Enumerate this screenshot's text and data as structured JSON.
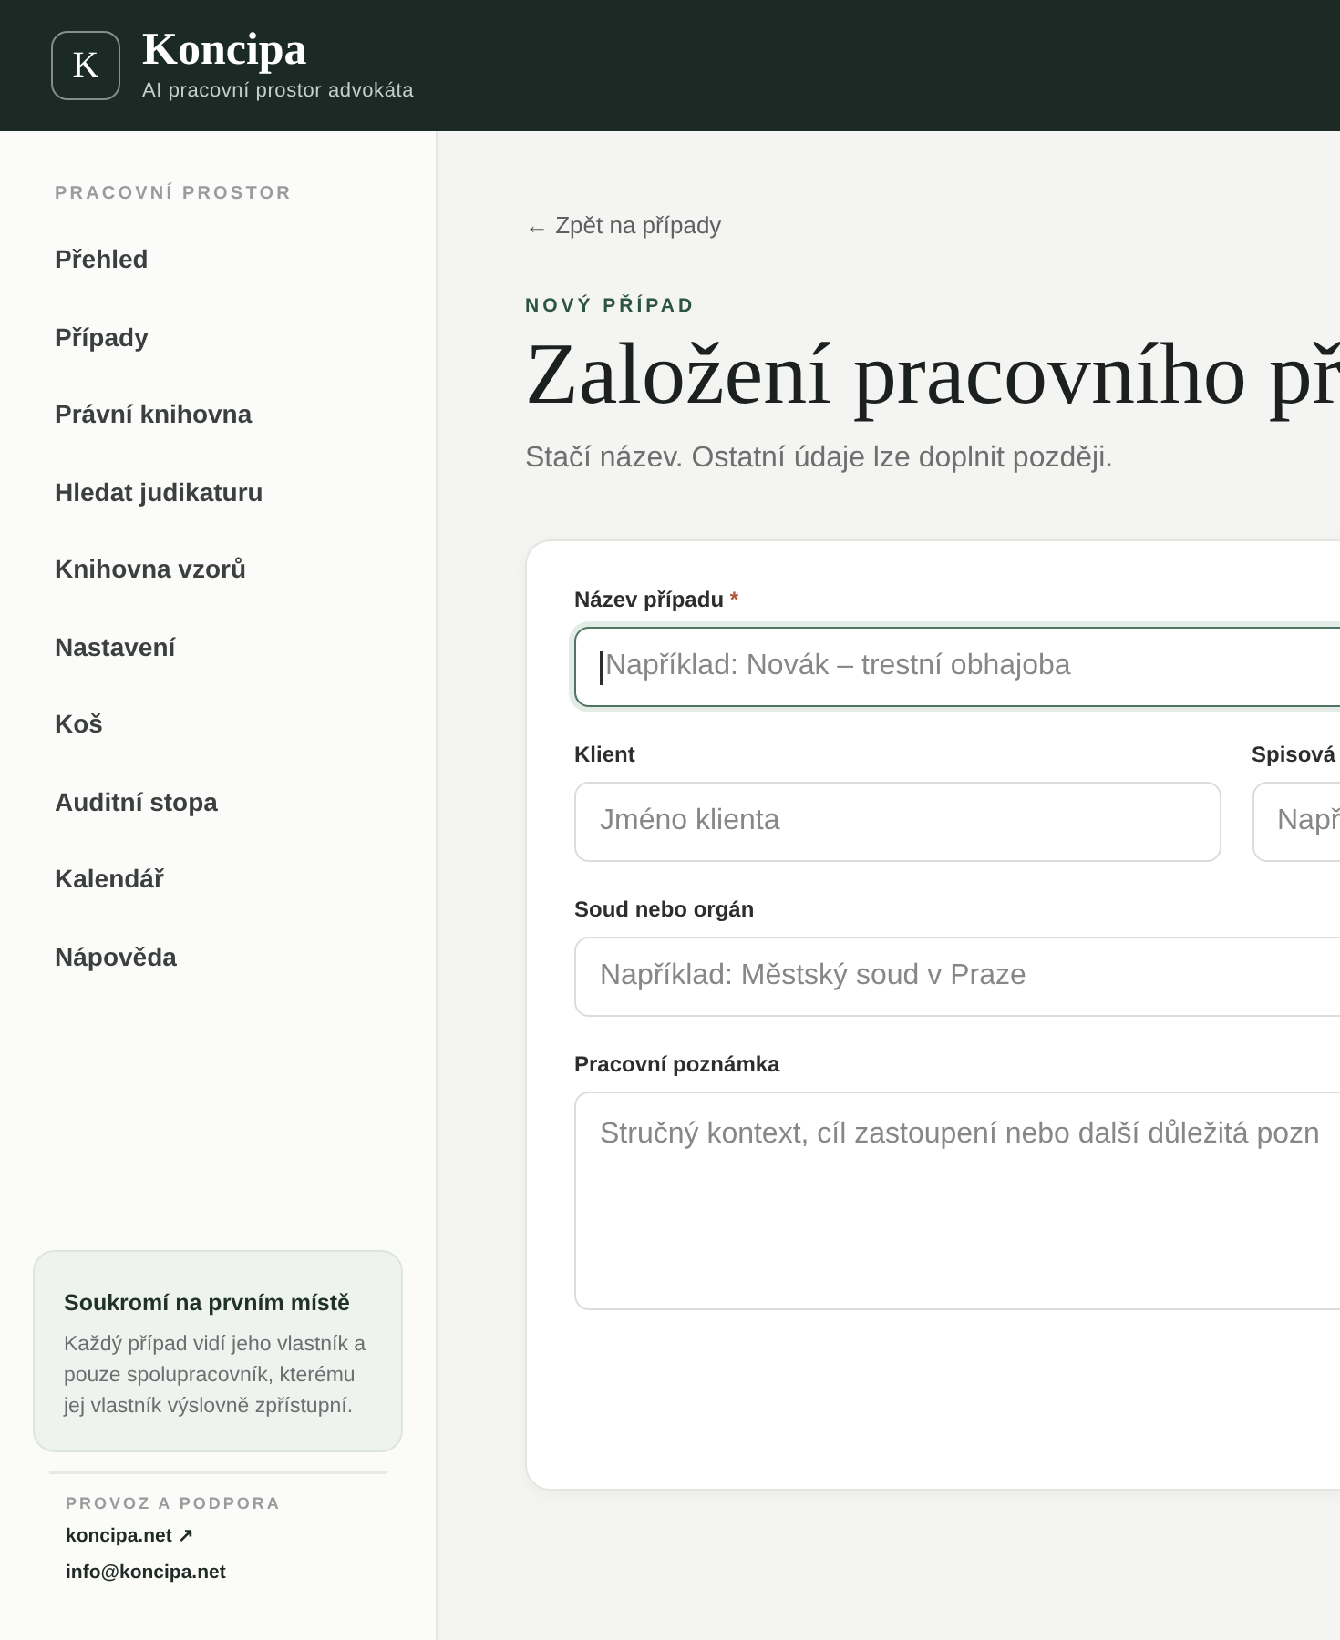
{
  "header": {
    "logo_letter": "K",
    "name": "Koncipa",
    "tagline": "AI pracovní prostor advokáta"
  },
  "sidebar": {
    "section_label": "PRACOVNÍ PROSTOR",
    "items": [
      {
        "label": "Přehled"
      },
      {
        "label": "Případy"
      },
      {
        "label": "Právní knihovna"
      },
      {
        "label": "Hledat judikaturu"
      },
      {
        "label": "Knihovna vzorů"
      },
      {
        "label": "Nastavení"
      },
      {
        "label": "Koš"
      },
      {
        "label": "Auditní stopa"
      },
      {
        "label": "Kalendář"
      },
      {
        "label": "Nápověda"
      }
    ],
    "privacy_card": {
      "title": "Soukromí na prvním místě",
      "text": "Každý případ vidí jeho vlastník a pouze spolupracovník, kterému jej vlastník výslovně zpřístupní."
    },
    "support": {
      "label": "PROVOZ A PODPORA",
      "links": [
        "koncipa.net ↗",
        "info@koncipa.net"
      ]
    }
  },
  "page": {
    "back_link": "← Zpět na případy",
    "eyebrow": "NOVÝ PŘÍPAD",
    "title": "Založení pracovního př",
    "subtitle": "Stačí název. Ostatní údaje lze doplnit později.",
    "form": {
      "rows": [
        [
          {
            "kind": "input",
            "label": "Název případu",
            "required_mark": "*",
            "placeholder": "Například: Novák – trestní obhajoba",
            "focused": true
          }
        ],
        [
          {
            "kind": "input",
            "label": "Klient",
            "placeholder": "Jméno klienta",
            "focused": false
          },
          {
            "kind": "input",
            "label": "Spisová",
            "placeholder": "Např",
            "focused": false
          }
        ],
        [
          {
            "kind": "input",
            "label": "Soud nebo orgán",
            "placeholder": "Například: Městský soud v Praze",
            "focused": false
          }
        ],
        [
          {
            "kind": "textarea",
            "label": "Pracovní poznámka",
            "placeholder": "Stručný kontext, cíl zastoupení nebo další důležitá pozn",
            "focused": false
          }
        ]
      ]
    }
  }
}
